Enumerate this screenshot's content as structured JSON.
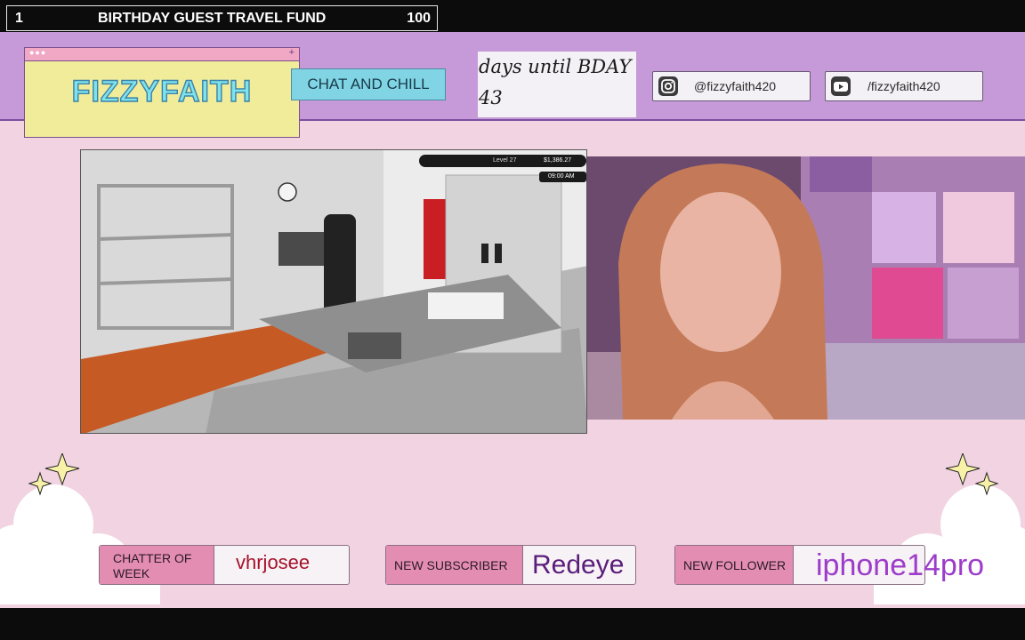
{
  "goal": {
    "left_value": "1",
    "title": "BIRTHDAY GUEST TRAVEL FUND",
    "right_value": "100"
  },
  "brand": {
    "name": "FIZZYFAITH",
    "window_dots": "●●●",
    "window_plus": "+"
  },
  "chat_button": "CHAT AND CHILL",
  "countdown": {
    "line1": "days until BDAY",
    "line2": "43"
  },
  "socials": [
    {
      "icon": "instagram-icon",
      "handle": "@fizzyfaith420"
    },
    {
      "icon": "youtube-icon",
      "handle": "/fizzyfaith420"
    }
  ],
  "game_hud": {
    "money": "$1,386.27",
    "time": "09:00 AM",
    "level": "Level 27"
  },
  "alerts": {
    "chatter": {
      "label": "CHATTER OF WEEK",
      "value": "vhrjosee"
    },
    "subscriber": {
      "label": "NEW SUBSCRIBER",
      "value": "Redeye"
    },
    "follower": {
      "label": "NEW FOLLOWER",
      "value": "iphone14pro"
    }
  },
  "colors": {
    "band": "#c69ad8",
    "logo_text": "#7fe3ec",
    "label_pink": "#e48db2",
    "chatter_value": "#a4122b",
    "value_purple": "#5a1d7a",
    "follower_value": "#9d3cc9"
  }
}
